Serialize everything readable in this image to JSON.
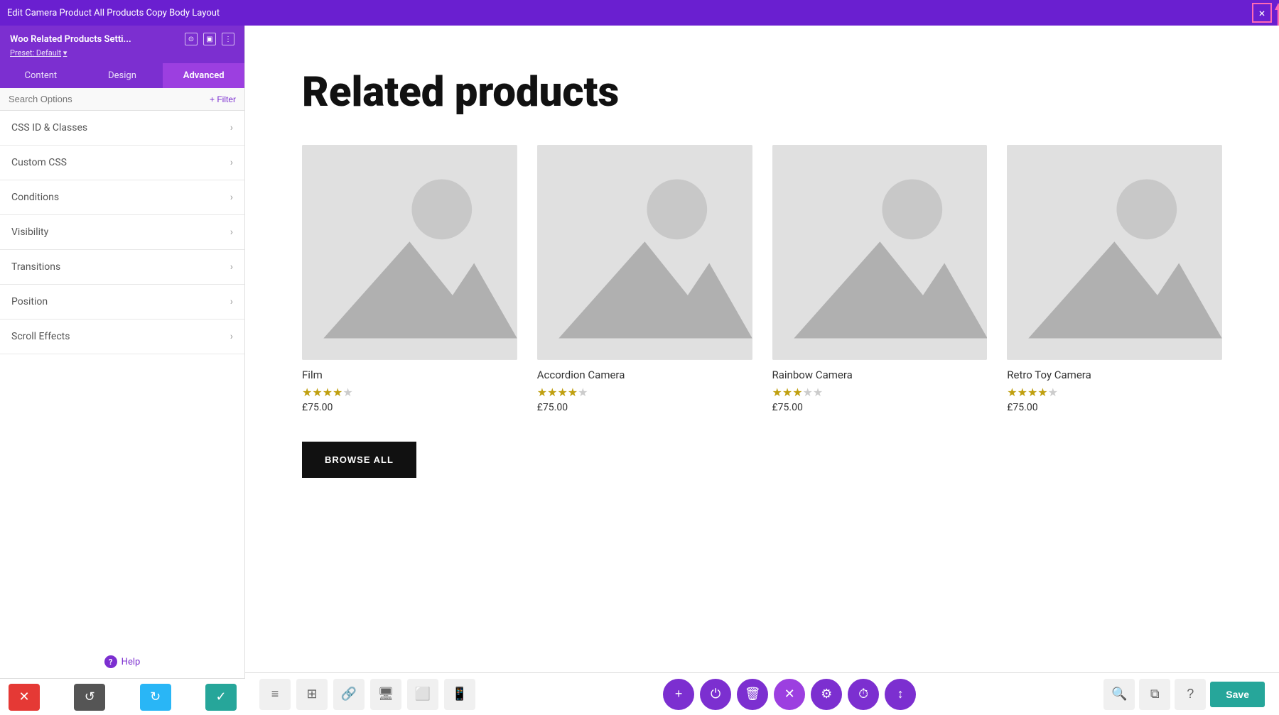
{
  "topbar": {
    "title": "Edit Camera Product All Products Copy Body Layout",
    "close_label": "×"
  },
  "sidebar": {
    "widget_title": "Woo Related Products Setti...",
    "preset_label": "Preset: Default",
    "tabs": [
      {
        "label": "Content",
        "active": false
      },
      {
        "label": "Design",
        "active": false
      },
      {
        "label": "Advanced",
        "active": true
      }
    ],
    "search_placeholder": "Search Options",
    "filter_label": "+ Filter",
    "accordion_items": [
      {
        "label": "CSS ID & Classes"
      },
      {
        "label": "Custom CSS"
      },
      {
        "label": "Conditions"
      },
      {
        "label": "Visibility"
      },
      {
        "label": "Transitions"
      },
      {
        "label": "Position"
      },
      {
        "label": "Scroll Effects"
      }
    ],
    "help_label": "Help"
  },
  "bottom_actions": {
    "close_label": "✕",
    "undo_label": "↺",
    "redo_label": "↻",
    "save_label": "✓"
  },
  "canvas": {
    "section_title": "Related products",
    "products": [
      {
        "name": "Film",
        "stars": "★★★★☆",
        "price": "£75.00"
      },
      {
        "name": "Accordion Camera",
        "stars": "★★★★☆",
        "price": "£75.00"
      },
      {
        "name": "Rainbow Camera",
        "stars": "★★★☆☆",
        "price": "£75.00"
      },
      {
        "name": "Retro Toy Camera",
        "stars": "★★★★☆",
        "price": "£75.00"
      }
    ],
    "browse_button": "BROWSE ALL"
  },
  "canvas_toolbar": {
    "tools": [
      "≡",
      "⊞",
      "🔗",
      "🖥",
      "⬜",
      "📱"
    ],
    "actions": [
      "+",
      "⏻",
      "🗑",
      "✕",
      "⚙",
      "🕐",
      "↕"
    ],
    "save_label": "Save"
  }
}
